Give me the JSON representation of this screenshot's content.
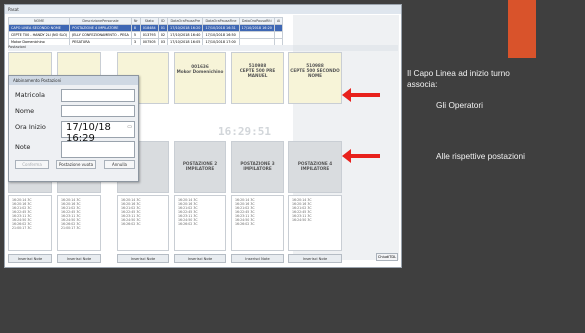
{
  "window_title": "Pasat",
  "grid": {
    "headers": [
      "NOME",
      "DescrizionePersonale",
      "Nr",
      "Stato",
      "ID",
      "DataOraPausaPre",
      "DataOraPausaFine",
      "DataOraPausaRiti",
      "Al"
    ],
    "rows": [
      [
        "CAPO LINEA SECONDO NOME",
        "POSTAZIONE 4 IMPILATORE",
        "8",
        "018484",
        "01",
        "17/10/2018 16:20",
        "17/10/2018 16:31",
        "17/10/2018 16:20",
        ""
      ],
      [
        "CEPTE T00 - HANDY 2LI (NO SLO)",
        "JELLY CONFEZIONAMENTO - PESA",
        "5",
        "013793",
        "02",
        "17/10/2018 16:40",
        "17/10/2018 16:50",
        "",
        ""
      ],
      [
        "Mokor Domenichino",
        "PESATURA",
        "3",
        "007505",
        "03",
        "17/10/2018 16:05",
        "17/10/2018 17:00",
        "",
        ""
      ]
    ]
  },
  "section_label": "Postazioni",
  "cards_top": [
    {
      "title": "",
      "style": "yellow"
    },
    {
      "title": "",
      "style": "yellow"
    },
    {
      "title": "",
      "style": "yellow"
    },
    {
      "title": "001636\nMokor Domenichino",
      "style": "yellow"
    },
    {
      "title": "510988\nCEPTE 500 PRE\nMANUEL",
      "style": "yellow"
    },
    {
      "title": "510988\nCEPTE 500 SECONDO\nNOME",
      "style": "yellow"
    }
  ],
  "cards_mid": [
    {
      "title": "",
      "style": "gray"
    },
    {
      "title": "",
      "style": "gray"
    },
    {
      "title": "",
      "style": "gray"
    },
    {
      "title": "POSTAZIONE 2\nIMPILATORE",
      "style": "gray"
    },
    {
      "title": "POSTAZIONE 3\nIMPILATORE",
      "style": "gray"
    },
    {
      "title": "POSTAZIONE 4\nIMPILATORE",
      "style": "gray"
    }
  ],
  "clock_text": "16:29:51",
  "list_lines": [
    "16:20:14 3C",
    "16:20:16 3C",
    "16:21:02 3C",
    "16:22:45 3C",
    "16:23:11 3C",
    "16:24:50 3C",
    "16:26:02 3C",
    "21:00:17 3C"
  ],
  "note_button_label": "Inserisci Note",
  "dialog": {
    "title": "Abbinamento Postazioni",
    "fields": [
      {
        "label": "Matricola",
        "value": ""
      },
      {
        "label": "Nome",
        "value": ""
      },
      {
        "label": "Ora Inizio",
        "value": "17/10/18 16:29"
      },
      {
        "label": "Note",
        "value": ""
      }
    ],
    "buttons": [
      "Conferma",
      "Postazione vuota",
      "Annulla"
    ]
  },
  "bottom_right_button": "ChiudiTDL",
  "side_text": {
    "line1": "Il Capo Linea ad inizio turno",
    "line2": "associa:",
    "operators": "Gli Operatori",
    "stations": "Alle rispettive postazioni"
  },
  "colors": {
    "slide_bg": "#3f3f3f",
    "accent_orange": "#d9532b",
    "arrow_red": "#e8211c",
    "selected_row": "#3e67b4"
  }
}
